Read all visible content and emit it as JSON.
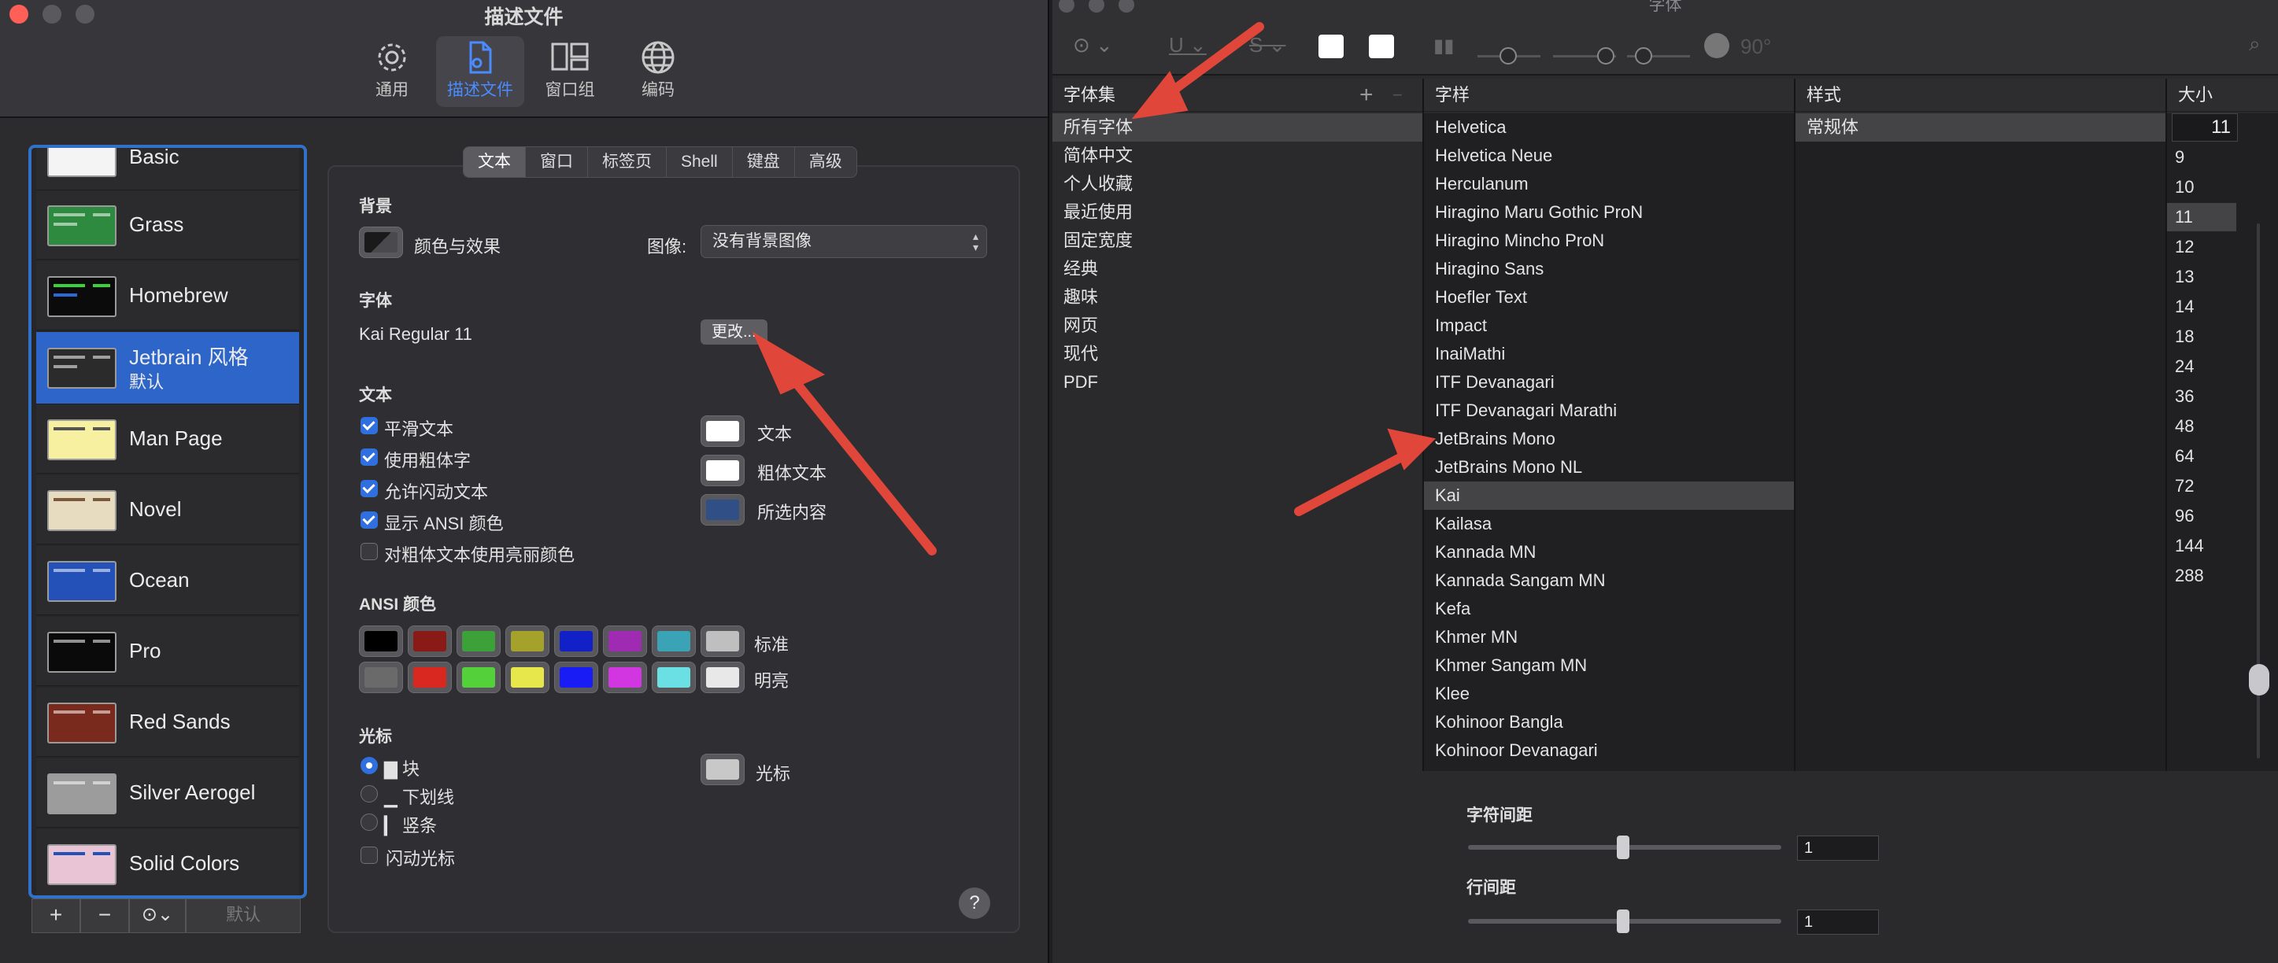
{
  "profiles_window": {
    "title": "描述文件",
    "toolbar": [
      {
        "label": "通用",
        "icon": "gear-icon"
      },
      {
        "label": "描述文件",
        "icon": "profile-doc-icon",
        "selected": true
      },
      {
        "label": "窗口组",
        "icon": "window-groups-icon"
      },
      {
        "label": "编码",
        "icon": "globe-icon"
      }
    ],
    "profiles": [
      {
        "name": "Basic",
        "thumb_bg": "#f4f4f4"
      },
      {
        "name": "Grass",
        "thumb_bg": "#2d8a3e"
      },
      {
        "name": "Homebrew",
        "thumb_bg": "#0b0b0b"
      },
      {
        "name": "Jetbrain 风格",
        "subtitle": "默认",
        "selected": true,
        "thumb_bg": "#2b2b2b"
      },
      {
        "name": "Man Page",
        "thumb_bg": "#f6f0a0"
      },
      {
        "name": "Novel",
        "thumb_bg": "#e8dcc0"
      },
      {
        "name": "Ocean",
        "thumb_bg": "#2451b8"
      },
      {
        "name": "Pro",
        "thumb_bg": "#0a0a0a"
      },
      {
        "name": "Red Sands",
        "thumb_bg": "#7a2a1c"
      },
      {
        "name": "Silver Aerogel",
        "thumb_bg": "#9c9c9c"
      },
      {
        "name": "Solid Colors",
        "thumb_bg": "#e8c4d4"
      }
    ],
    "bottom_bar": {
      "add": "+",
      "remove": "−",
      "more": "⊙⌄",
      "default": "默认"
    },
    "tabs": [
      "文本",
      "窗口",
      "标签页",
      "Shell",
      "键盘",
      "高级"
    ],
    "background": {
      "heading": "背景",
      "color_effects": "颜色与效果",
      "image_label": "图像:",
      "image_value": "没有背景图像"
    },
    "font": {
      "heading": "字体",
      "value": "Kai Regular 11",
      "change_button": "更改..."
    },
    "text": {
      "heading": "文本",
      "options": [
        {
          "label": "平滑文本",
          "checked": true
        },
        {
          "label": "使用粗体字",
          "checked": true
        },
        {
          "label": "允许闪动文本",
          "checked": true
        },
        {
          "label": "显示 ANSI 颜色",
          "checked": true
        },
        {
          "label": "对粗体文本使用亮丽颜色",
          "checked": false
        }
      ],
      "colors": [
        {
          "label": "文本",
          "color": "#ffffff"
        },
        {
          "label": "粗体文本",
          "color": "#ffffff"
        },
        {
          "label": "所选内容",
          "color": "#2f4f86"
        }
      ]
    },
    "ansi": {
      "heading": "ANSI 颜色",
      "normal_label": "标准",
      "bright_label": "明亮",
      "normal": [
        "#000000",
        "#8a1a16",
        "#3da13a",
        "#a5a22c",
        "#1220c8",
        "#a02bb3",
        "#3aa3b5",
        "#bfbfbf"
      ],
      "bright": [
        "#6a6a6a",
        "#d8281f",
        "#54d13a",
        "#e7e64a",
        "#1a1cf6",
        "#d236e0",
        "#6ae0e4",
        "#e8e8e8"
      ]
    },
    "cursor": {
      "heading": "光标",
      "options": [
        {
          "label": "▇ 块",
          "checked": true
        },
        {
          "label": "▁ 下划线",
          "checked": false
        },
        {
          "label": "▎ 竖条",
          "checked": false
        }
      ],
      "blink": "闪动光标",
      "color_label": "光标",
      "color": "#c8c8c8"
    },
    "help": "?"
  },
  "font_window": {
    "title": "字体",
    "toolbar": {
      "more": "⊙",
      "underline": "U",
      "strikethrough": "S",
      "angle": "90°"
    },
    "columns": {
      "collections_header": "字体集",
      "add": "+",
      "remove": "−",
      "family_header": "字样",
      "style_header": "样式",
      "size_header": "大小"
    },
    "collections": [
      "所有字体",
      "简体中文",
      "个人收藏",
      "最近使用",
      "固定宽度",
      "经典",
      "趣味",
      "网页",
      "现代",
      "PDF"
    ],
    "families": [
      "Helvetica",
      "Helvetica Neue",
      "Herculanum",
      "Hiragino Maru Gothic ProN",
      "Hiragino Mincho ProN",
      "Hiragino Sans",
      "Hoefler Text",
      "Impact",
      "InaiMathi",
      "ITF Devanagari",
      "ITF Devanagari Marathi",
      "JetBrains Mono",
      "JetBrains Mono NL",
      "Kai",
      "Kailasa",
      "Kannada MN",
      "Kannada Sangam MN",
      "Kefa",
      "Khmer MN",
      "Khmer Sangam MN",
      "Klee",
      "Kohinoor Bangla",
      "Kohinoor Devanagari"
    ],
    "selected_family": "Kai",
    "styles": [
      "常规体"
    ],
    "size_field": "11",
    "sizes": [
      "9",
      "10",
      "11",
      "12",
      "13",
      "14",
      "18",
      "24",
      "36",
      "48",
      "64",
      "72",
      "96",
      "144",
      "288"
    ],
    "selected_size": "11",
    "character_spacing": {
      "label": "字符间距",
      "value": "1"
    },
    "line_spacing": {
      "label": "行间距",
      "value": "1"
    }
  },
  "accent_color": "#2f6fe0",
  "annotation_color": "#e0473a"
}
